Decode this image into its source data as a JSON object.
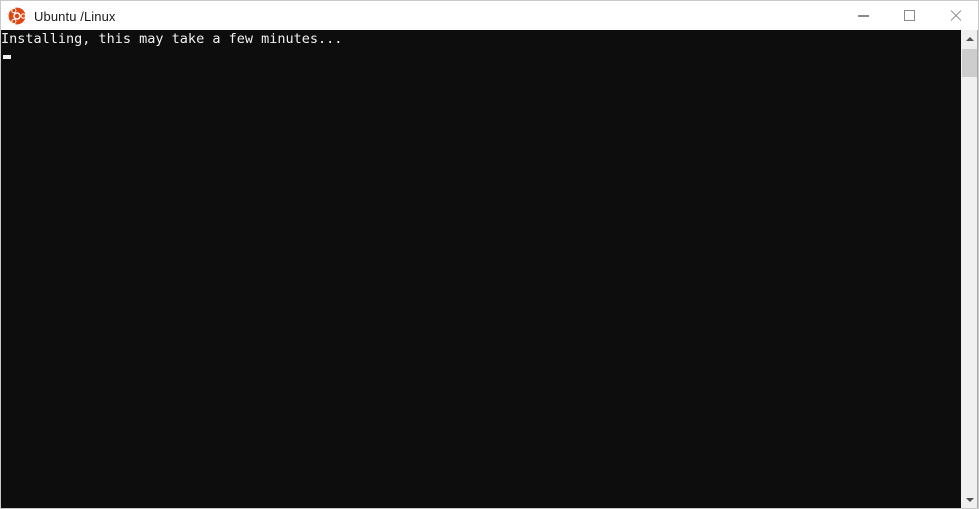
{
  "window": {
    "title": "Ubuntu /Linux",
    "icon": "ubuntu-logo-icon",
    "controls": {
      "minimize_label": "—",
      "maximize_label": "□",
      "close_label": "×"
    },
    "colors": {
      "titlebar_background": "#ffffff",
      "titlebar_text": "#1a1a1a",
      "window_border": "#c9c9c9",
      "control_glyph": "#8a8a8a",
      "ubuntu_orange": "#dd4814",
      "terminal_background": "#0d0d0d",
      "terminal_text": "#f2f2f2",
      "scrollbar_track": "#f0f0f0",
      "scrollbar_thumb": "#cdcdcd",
      "scrollbar_arrow": "#505050"
    }
  },
  "terminal": {
    "lines": [
      "Installing, this may take a few minutes..."
    ],
    "cursor_visible": true
  },
  "scrollbar": {
    "up_arrow": "scroll-up-arrow-icon",
    "down_arrow": "scroll-down-arrow-icon",
    "thumb_position_percent": 0,
    "thumb_size_percent": 6
  }
}
